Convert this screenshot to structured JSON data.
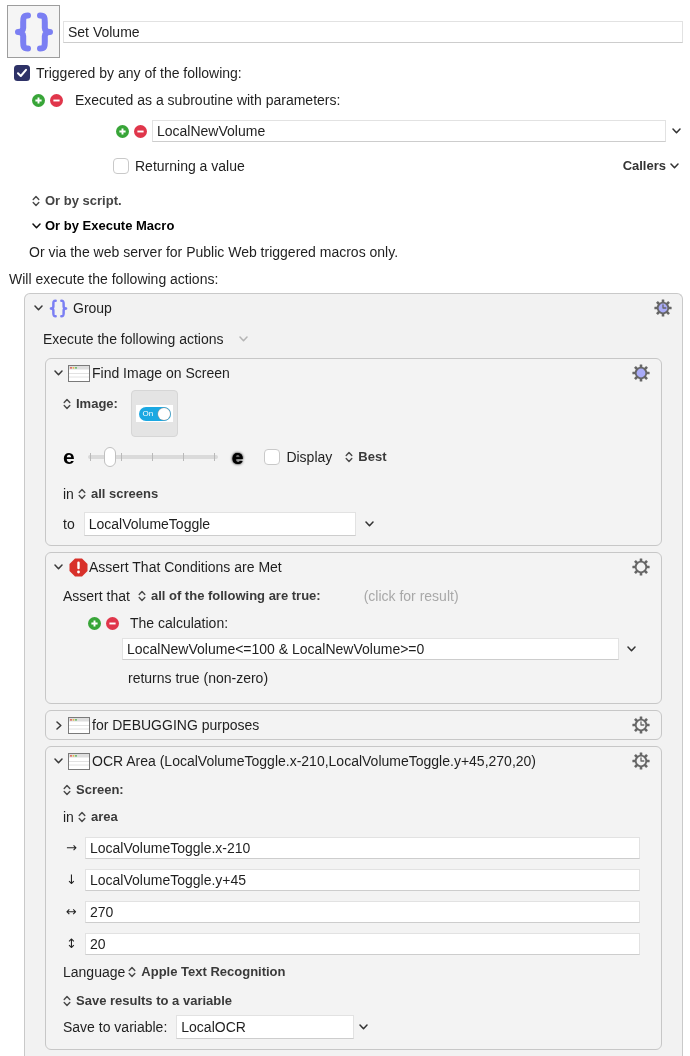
{
  "macro": {
    "name": "Set Volume"
  },
  "trigger_enabled": {
    "label": "Triggered by any of the following:",
    "checked": true
  },
  "subroutine": {
    "label": "Executed as a subroutine with parameters:",
    "parameters": [
      {
        "value": "LocalNewVolume"
      }
    ],
    "returning": {
      "label": "Returning a value",
      "checked": false
    },
    "callers": "Callers"
  },
  "sections": [
    {
      "kind": "popup",
      "label": "Or by script."
    },
    {
      "kind": "disclosure",
      "label": "Or by Execute Macro",
      "expanded": true
    }
  ],
  "web_note": "Or via the web server for Public Web triggered macros only.",
  "actions_heading": "Will execute the following actions:",
  "group": {
    "title": "Group",
    "expanded": true,
    "gear": {
      "tinted": true,
      "timeout": true
    },
    "mode": "Execute the following actions",
    "actions": [
      {
        "kind": "find_image",
        "title": "Find Image on Screen",
        "expanded": true,
        "gear": {
          "tinted": true,
          "timeout": false
        },
        "image_label": "Image:",
        "image": {
          "text": "On",
          "on": true
        },
        "fuzz": {
          "min_label": "e",
          "max_label": "e",
          "level": 0.14
        },
        "display": {
          "label": "Display",
          "checked": false
        },
        "quality": "Best",
        "in_label": "in",
        "screens": "all screens",
        "to_label": "to",
        "variable": "LocalVolumeToggle"
      },
      {
        "kind": "assert",
        "title": "Assert That Conditions are Met",
        "expanded": true,
        "gear": {
          "tinted": false,
          "timeout": false
        },
        "prefix": "Assert that",
        "mode": "all of the following are true:",
        "result_hint": "(click for result)",
        "conditions": [
          {
            "label": "The calculation:",
            "value": "LocalNewVolume<=100 & LocalNewVolume>=0",
            "result": "returns true (non-zero)"
          }
        ]
      },
      {
        "kind": "action",
        "title": "for DEBUGGING purposes",
        "expanded": false,
        "gear": {
          "tinted": false,
          "timeout": true
        }
      },
      {
        "kind": "ocr",
        "title": "OCR Area (LocalVolumeToggle.x-210,LocalVolumeToggle.y+45,270,20)",
        "expanded": true,
        "gear": {
          "tinted": false,
          "timeout": true
        },
        "source": "Screen:",
        "in_label": "in",
        "area": "area",
        "coordinates": [
          {
            "symbol": "→",
            "value": "LocalVolumeToggle.x-210"
          },
          {
            "symbol": "↓",
            "value": "LocalVolumeToggle.y+45"
          },
          {
            "symbol": "↔",
            "value": "270"
          },
          {
            "symbol": "↕",
            "value": "20"
          }
        ],
        "language_label": "Language",
        "language": "Apple Text Recognition",
        "save_mode": "Save results to a variable",
        "save_label": "Save to variable:",
        "variable": "LocalOCR"
      }
    ]
  }
}
